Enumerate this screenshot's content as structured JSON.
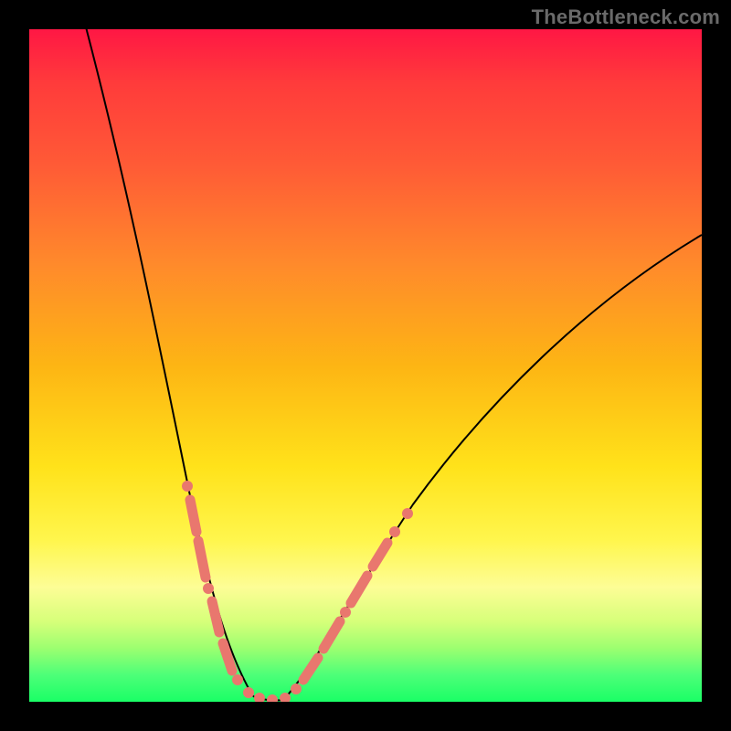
{
  "watermark": "TheBottleneck.com",
  "background": {
    "frame_color": "#000000",
    "gradient_stops": [
      {
        "pos": 0,
        "color": "#ff1744"
      },
      {
        "pos": 0.08,
        "color": "#ff3b3b"
      },
      {
        "pos": 0.2,
        "color": "#ff5a36"
      },
      {
        "pos": 0.35,
        "color": "#ff8a2b"
      },
      {
        "pos": 0.5,
        "color": "#fdb514"
      },
      {
        "pos": 0.65,
        "color": "#ffe21a"
      },
      {
        "pos": 0.76,
        "color": "#fff64d"
      },
      {
        "pos": 0.83,
        "color": "#fdfd96"
      },
      {
        "pos": 0.88,
        "color": "#d7ff7a"
      },
      {
        "pos": 0.92,
        "color": "#9dff70"
      },
      {
        "pos": 0.96,
        "color": "#4dff78"
      },
      {
        "pos": 1.0,
        "color": "#1aff66"
      }
    ]
  },
  "chart_data": {
    "type": "line",
    "title": "",
    "xlabel": "",
    "ylabel": "",
    "xlim": [
      0,
      100
    ],
    "ylim": [
      0,
      100
    ],
    "note": "Values are approximate pixel-relative readings (0-100) of the V-shaped bottleneck curve. Minimum ~x=33, y≈0.",
    "series": [
      {
        "name": "curve-left",
        "x": [
          8,
          10,
          12,
          14,
          16,
          18,
          20,
          22,
          24,
          26,
          28,
          30,
          32,
          33
        ],
        "y": [
          100,
          92,
          84,
          75,
          66,
          57,
          48,
          40,
          32,
          24,
          17,
          10,
          4,
          0
        ]
      },
      {
        "name": "curve-right",
        "x": [
          33,
          36,
          40,
          44,
          48,
          52,
          56,
          60,
          65,
          70,
          75,
          80,
          85,
          90,
          95,
          100
        ],
        "y": [
          0,
          3,
          8,
          13,
          18,
          23,
          28,
          33,
          39,
          45,
          50,
          55,
          59,
          63,
          66,
          69
        ]
      }
    ],
    "markers": {
      "color": "#e9776e",
      "left_band_x": [
        22,
        33
      ],
      "right_band_x": [
        33,
        43
      ],
      "description": "Salmon dotted/segmented overlay along the curve near the vertex on both sides."
    }
  }
}
